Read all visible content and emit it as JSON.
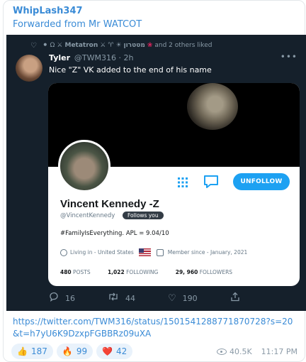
{
  "message": {
    "sender": "WhipLash347",
    "forwarded_from": "Forwarded from Mr WATCOT",
    "link": "https://twitter.com/TWM316/status/1501541288771870728?s=20&t=h7yU6K9DzxpFGBBRz09uXA",
    "views": "40.5K",
    "time": "11:17 PM",
    "reactions": [
      {
        "emoji": "👍",
        "count": "187"
      },
      {
        "emoji": "🔥",
        "count": "99"
      },
      {
        "emoji": "❤️",
        "count": "42"
      }
    ]
  },
  "tweet": {
    "liked_by_name": "Metatron",
    "liked_by_hebrew": "מטטרון",
    "liked_suffix": "and 2 others liked",
    "author_name": "Tyler",
    "author_handle": "@TWM316 · 2h",
    "text": "Nice \"Z\" VK added to the end of his name",
    "replies": "16",
    "retweets": "44",
    "likes": "190",
    "more_icon": "more-dots-icon",
    "accent": "#1da1f2",
    "background": "#15202b"
  },
  "profile_card": {
    "name": "Vincent Kennedy -Z",
    "handle": "@VincentKennedy",
    "follows_you": "Follows you",
    "unfollow_label": "UNFOLLOW",
    "bio": "#FamilyIsEverything. APL = 9.04/10",
    "location": "Living in - United States",
    "member_since": "Member since - January, 2021",
    "posts_count": "480",
    "posts_label": "POSTS",
    "following_count": "1,022",
    "following_label": "FOLLOWING",
    "followers_count": "29, 960",
    "followers_label": "FOLLOWERS"
  }
}
